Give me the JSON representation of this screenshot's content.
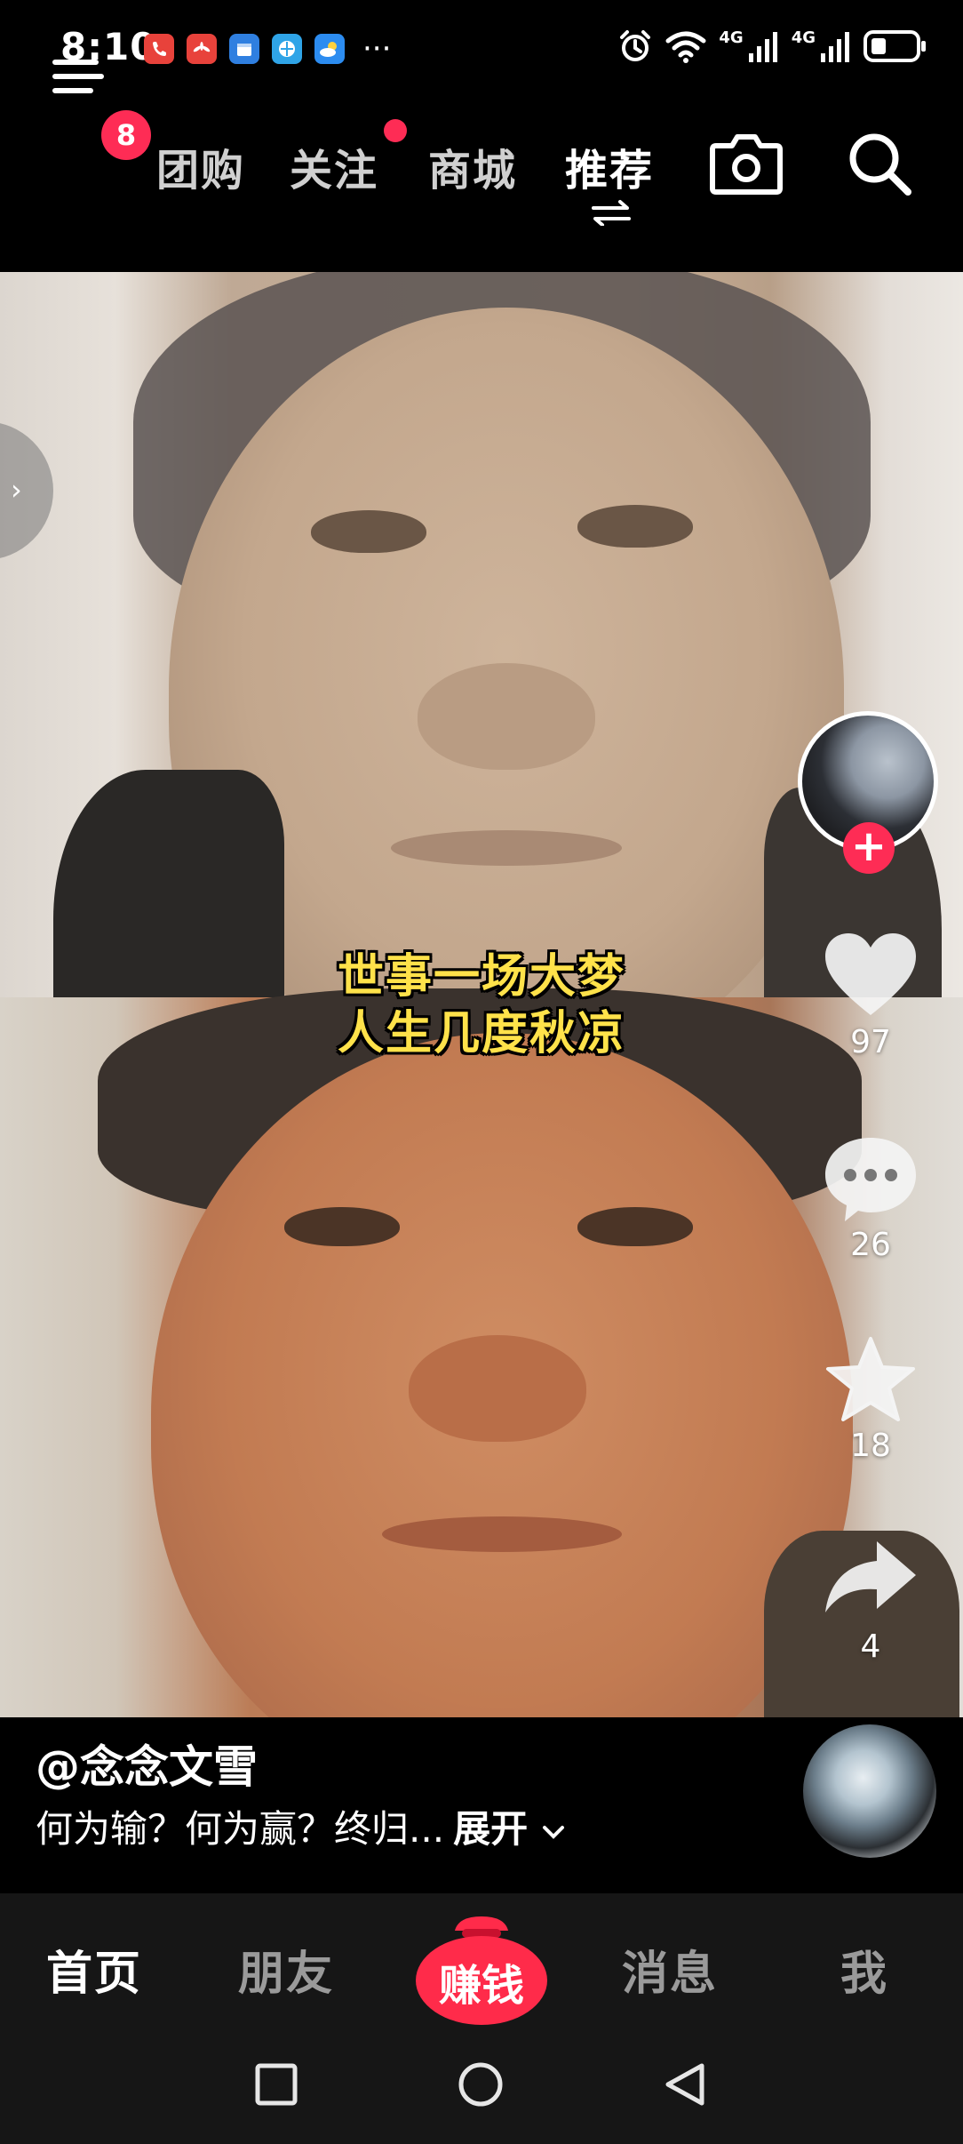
{
  "status_bar": {
    "time": "8:10",
    "app_icons": [
      "phone-app-icon",
      "huawei-app-icon",
      "calendar-app-icon",
      "browser-app-icon",
      "weather-app-icon"
    ],
    "overflow": "···",
    "network_1": "4G",
    "network_2": "4G"
  },
  "top_nav": {
    "menu_badge": "8",
    "tabs": [
      {
        "label": "团购"
      },
      {
        "label": "关注"
      },
      {
        "label": "商城"
      },
      {
        "label": "推荐"
      }
    ],
    "active_tab": "推荐"
  },
  "video": {
    "subtitle_line1": "世事一场大梦",
    "subtitle_line2": "人生几度秋凉"
  },
  "rail": {
    "likes": "97",
    "comments": "26",
    "favorites": "18",
    "shares": "4"
  },
  "caption": {
    "author": "@念念文雪",
    "description": "何为输？何为赢？终归...",
    "expand": "展开"
  },
  "bottom_nav": {
    "home": "首页",
    "friends": "朋友",
    "earn": "赚钱",
    "messages": "消息",
    "me": "我"
  },
  "colors": {
    "accent": "#fe2c55",
    "subtitle": "#ffe24a",
    "nav_bg": "#161616",
    "background": "#000000"
  }
}
